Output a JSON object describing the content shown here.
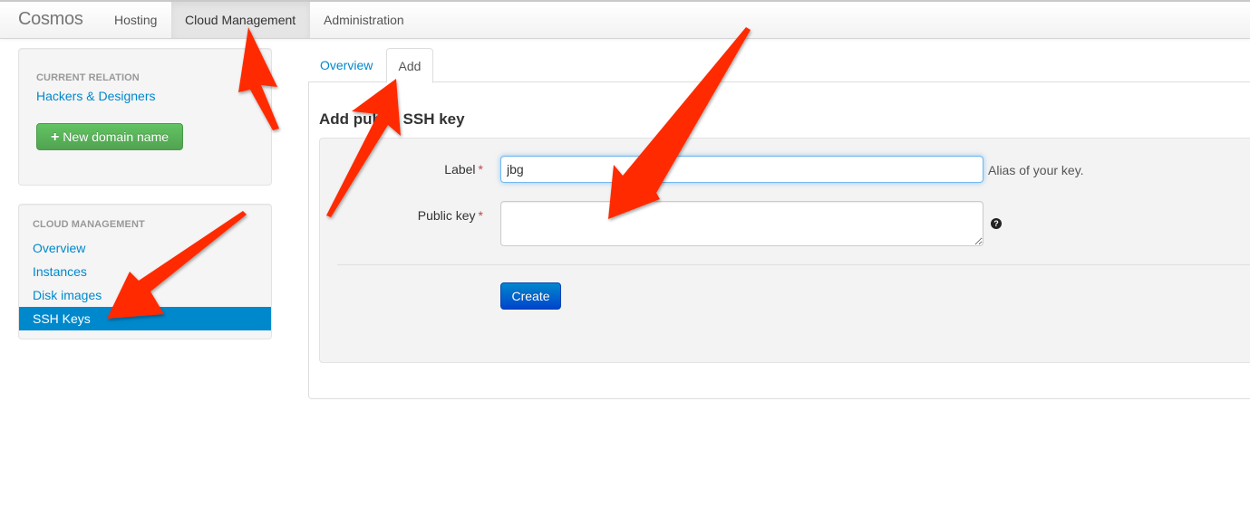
{
  "navbar": {
    "brand": "Cosmos",
    "items": [
      {
        "label": "Hosting",
        "active": false
      },
      {
        "label": "Cloud Management",
        "active": true
      },
      {
        "label": "Administration",
        "active": false
      }
    ]
  },
  "sidebar": {
    "relation": {
      "header": "CURRENT RELATION",
      "name": "Hackers & Designers",
      "new_domain_button": "New domain name",
      "new_domain_icon": "plus-icon"
    },
    "cloud": {
      "header": "CLOUD MANAGEMENT",
      "items": [
        {
          "label": "Overview",
          "active": false
        },
        {
          "label": "Instances",
          "active": false
        },
        {
          "label": "Disk images",
          "active": false
        },
        {
          "label": "SSH Keys",
          "active": true
        }
      ]
    }
  },
  "main": {
    "tabs": [
      {
        "label": "Overview",
        "active": false
      },
      {
        "label": "Add",
        "active": true
      }
    ],
    "form": {
      "title": "Add public SSH key",
      "required_marker": "*",
      "label_field": {
        "label": "Label",
        "value": "jbg",
        "help": "Alias of your key."
      },
      "public_key_field": {
        "label": "Public key",
        "value": "",
        "help_icon": "question-circle-icon",
        "help_glyph": "?"
      },
      "submit_label": "Create"
    }
  },
  "annotations": {
    "arrow_color": "#ff2a00",
    "arrows": [
      "arrow-to-cloud-management",
      "arrow-to-add-tab",
      "arrow-to-public-key",
      "arrow-to-ssh-keys"
    ]
  }
}
